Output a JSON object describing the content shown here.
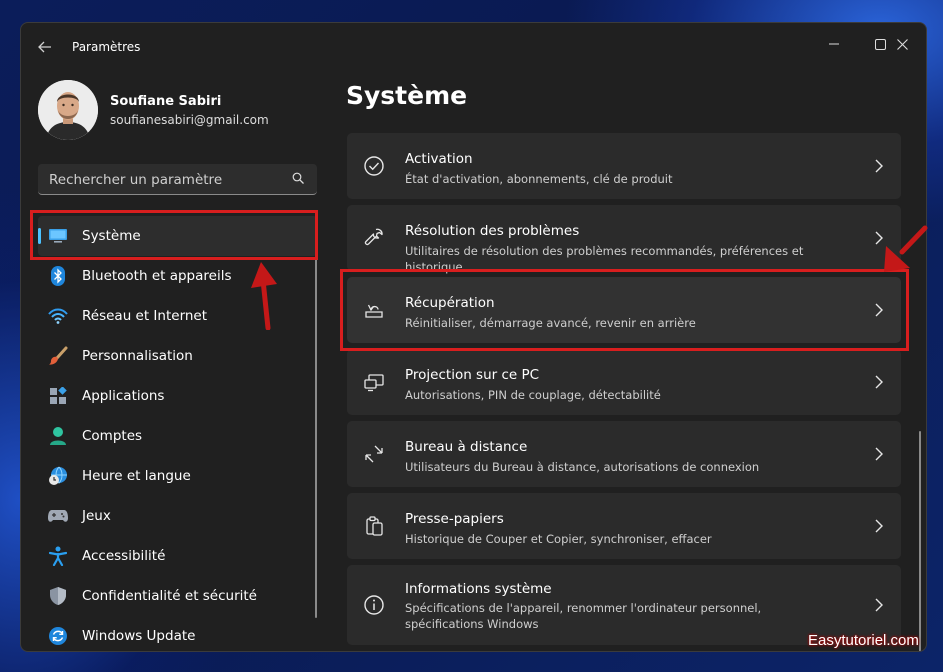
{
  "window": {
    "title": "Paramètres"
  },
  "profile": {
    "name": "Soufiane Sabiri",
    "email": "soufianesabiri@gmail.com"
  },
  "search": {
    "placeholder": "Rechercher un paramètre"
  },
  "nav": {
    "items": [
      {
        "label": "Système",
        "icon": "monitor-icon",
        "selected": true
      },
      {
        "label": "Bluetooth et appareils",
        "icon": "bluetooth-icon"
      },
      {
        "label": "Réseau et Internet",
        "icon": "wifi-icon"
      },
      {
        "label": "Personnalisation",
        "icon": "brush-icon"
      },
      {
        "label": "Applications",
        "icon": "apps-icon"
      },
      {
        "label": "Comptes",
        "icon": "person-icon"
      },
      {
        "label": "Heure et langue",
        "icon": "clock-globe-icon"
      },
      {
        "label": "Jeux",
        "icon": "gamepad-icon"
      },
      {
        "label": "Accessibilité",
        "icon": "accessibility-icon"
      },
      {
        "label": "Confidentialité et sécurité",
        "icon": "shield-icon"
      },
      {
        "label": "Windows Update",
        "icon": "windows-update-icon"
      }
    ]
  },
  "main": {
    "title": "Système",
    "cards": [
      {
        "title": "Activation",
        "subtitle": "État d'activation, abonnements, clé de produit",
        "icon": "check-circle-icon"
      },
      {
        "title": "Résolution des problèmes",
        "subtitle": "Utilitaires de résolution des problèmes recommandés, préférences et historique",
        "icon": "wrench-icon"
      },
      {
        "title": "Récupération",
        "subtitle": "Réinitialiser, démarrage avancé, revenir en arrière",
        "icon": "recovery-icon",
        "highlighted": true
      },
      {
        "title": "Projection sur ce PC",
        "subtitle": "Autorisations, PIN de couplage, détectabilité",
        "icon": "projection-icon"
      },
      {
        "title": "Bureau à distance",
        "subtitle": "Utilisateurs du Bureau à distance, autorisations de connexion",
        "icon": "remote-desktop-icon"
      },
      {
        "title": "Presse-papiers",
        "subtitle": "Historique de Couper et Copier, synchroniser, effacer",
        "icon": "clipboard-icon"
      },
      {
        "title": "Informations système",
        "subtitle": "Spécifications de l'appareil, renommer l'ordinateur personnel, spécifications Windows",
        "icon": "info-icon"
      }
    ]
  },
  "watermark": "Easytutoriel.com",
  "colors": {
    "accent": "#4cc2ff",
    "annotation": "#d81e1e",
    "window_bg": "#202020",
    "card_bg": "#2b2b2b"
  }
}
